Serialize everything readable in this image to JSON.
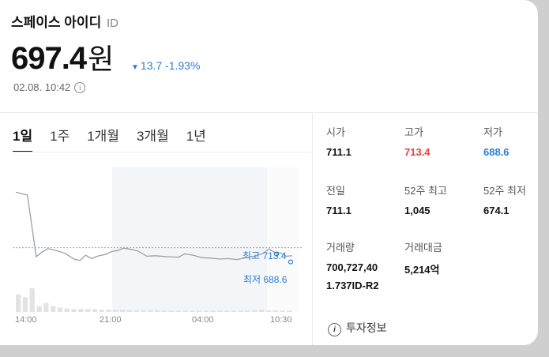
{
  "header": {
    "title": "스페이스 아이디",
    "ticker": "ID",
    "price": "697.4",
    "price_unit": "원",
    "change_amount": "13.7",
    "change_pct": "-1.93%",
    "timestamp": "02.08. 10:42",
    "info_glyph": "i"
  },
  "tabs": [
    "1일",
    "1주",
    "1개월",
    "3개월",
    "1년"
  ],
  "chart_labels": {
    "high_label": "최고",
    "high_value": "713.4",
    "low_label": "최저",
    "low_value": "688.6"
  },
  "chart_data": {
    "type": "line",
    "x_ticks": [
      "14:00",
      "21:00",
      "04:00",
      "10:30"
    ],
    "price_series": [
      {
        "x": 0,
        "y": 711.1
      },
      {
        "x": 4,
        "y": 710.5
      },
      {
        "x": 7,
        "y": 697.5
      },
      {
        "x": 9,
        "y": 698.5
      },
      {
        "x": 11,
        "y": 699.2
      },
      {
        "x": 14,
        "y": 698.8
      },
      {
        "x": 17,
        "y": 698.2
      },
      {
        "x": 20,
        "y": 697.0
      },
      {
        "x": 22,
        "y": 696.7
      },
      {
        "x": 24,
        "y": 697.8
      },
      {
        "x": 26,
        "y": 697.1
      },
      {
        "x": 28,
        "y": 697.6
      },
      {
        "x": 31,
        "y": 698.0
      },
      {
        "x": 33,
        "y": 698.6
      },
      {
        "x": 35,
        "y": 698.8
      },
      {
        "x": 37,
        "y": 699.3
      },
      {
        "x": 40,
        "y": 699.0
      },
      {
        "x": 42,
        "y": 698.7
      },
      {
        "x": 45,
        "y": 697.6
      },
      {
        "x": 48,
        "y": 697.7
      },
      {
        "x": 52,
        "y": 697.5
      },
      {
        "x": 56,
        "y": 697.4
      },
      {
        "x": 58,
        "y": 698.1
      },
      {
        "x": 61,
        "y": 697.8
      },
      {
        "x": 64,
        "y": 697.3
      },
      {
        "x": 67,
        "y": 697.2
      },
      {
        "x": 70,
        "y": 697.0
      },
      {
        "x": 73,
        "y": 697.1
      },
      {
        "x": 76,
        "y": 696.9
      },
      {
        "x": 79,
        "y": 697.3
      },
      {
        "x": 82,
        "y": 697.6
      },
      {
        "x": 85,
        "y": 698.2
      },
      {
        "x": 87,
        "y": 699.1
      },
      {
        "x": 89,
        "y": 698.4
      },
      {
        "x": 91,
        "y": 698.3
      },
      {
        "x": 93,
        "y": 697.6
      },
      {
        "x": 95,
        "y": 697.7
      }
    ],
    "prev_close": 699.4,
    "y_range": [
      688.0,
      713.0
    ],
    "volume": [
      6,
      5,
      8,
      2,
      3,
      2,
      1.5,
      1.2,
      1,
      1,
      1,
      1,
      0.8,
      0.8,
      0.8,
      0.8,
      0.7,
      0.6,
      0.6,
      0.6,
      0.6,
      0.5,
      0.5,
      0.5,
      0.5,
      0.5,
      0.5,
      0.5,
      0.5,
      0.5,
      0.5,
      0.5,
      0.5,
      0.6,
      0.6,
      0.8,
      0.6,
      0.6,
      0.5,
      0.5
    ],
    "colors": {
      "line": "#9aa0a6",
      "marker": "#2b7fd7",
      "volume": "#e3e3e3",
      "shade": "#f3f5f9"
    }
  },
  "stats": {
    "open_label": "시가",
    "open": "711.1",
    "high_label": "고가",
    "high": "713.4",
    "low_label": "저가",
    "low": "688.6",
    "prev_label": "전일",
    "prev": "711.1",
    "w52_high_label": "52주 최고",
    "w52_high": "1,045",
    "w52_low_label": "52주 최저",
    "w52_low": "674.1",
    "volume_label": "거래량",
    "volume": "700,727,40",
    "volume_cont": "1.737ID-R2",
    "turnover_label": "거래대금",
    "turnover": "5,214억"
  },
  "footer": {
    "invest_label": "투자정보",
    "invest_glyph": "i"
  },
  "colors": {
    "up": "#e2433b",
    "down": "#2b7fd7"
  }
}
